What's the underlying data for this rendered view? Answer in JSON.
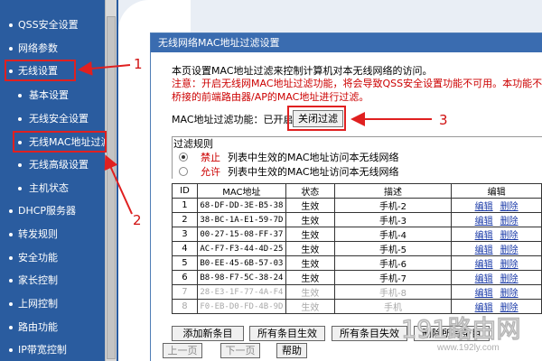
{
  "sidebar": {
    "items": [
      {
        "label": "QSS安全设置"
      },
      {
        "label": "网络参数"
      },
      {
        "label": "无线设置"
      },
      {
        "label": "基本设置"
      },
      {
        "label": "无线安全设置"
      },
      {
        "label": "无线MAC地址过滤"
      },
      {
        "label": "无线高级设置"
      },
      {
        "label": "主机状态"
      },
      {
        "label": "DHCP服务器"
      },
      {
        "label": "转发规则"
      },
      {
        "label": "安全功能"
      },
      {
        "label": "家长控制"
      },
      {
        "label": "上网控制"
      },
      {
        "label": "路由功能"
      },
      {
        "label": "IP带宽控制"
      }
    ]
  },
  "page": {
    "title": "无线网络MAC地址过滤设置",
    "intro": "本页设置MAC地址过滤来控制计算机对本无线网络的访问。",
    "warning_line1": "注意：开启无线网MAC地址过滤功能，将会导致QSS安全设置功能不可用。本功能不对WDS",
    "warning_line2": "桥接的前端路由器/AP的MAC地址进行过滤。",
    "filter_status_label": "MAC地址过滤功能：已开启",
    "close_filter_button": "关闭过滤",
    "rules_title": "过滤规则",
    "rule_options": [
      {
        "keyword": "禁止",
        "text": "列表中生效的MAC地址访问本无线网络",
        "selected": true
      },
      {
        "keyword": "允许",
        "text": "列表中生效的MAC地址访问本无线网络",
        "selected": false
      }
    ]
  },
  "table": {
    "headers": [
      "ID",
      "MAC地址",
      "状态",
      "描述",
      "编辑"
    ],
    "edit_label": "编辑",
    "delete_label": "删除",
    "rows": [
      {
        "id": "1",
        "mac": "68-DF-DD-3E-B5-38",
        "status": "生效",
        "desc": "手机-2"
      },
      {
        "id": "2",
        "mac": "38-BC-1A-E1-59-7D",
        "status": "生效",
        "desc": "手机-3"
      },
      {
        "id": "3",
        "mac": "00-27-15-08-FF-37",
        "status": "生效",
        "desc": "手机-4"
      },
      {
        "id": "4",
        "mac": "AC-F7-F3-44-4D-25",
        "status": "生效",
        "desc": "手机-5"
      },
      {
        "id": "5",
        "mac": "B0-EE-45-6B-57-03",
        "status": "生效",
        "desc": "手机-6"
      },
      {
        "id": "6",
        "mac": "B8-98-F7-5C-38-24",
        "status": "生效",
        "desc": "手机-7"
      },
      {
        "id": "7",
        "mac": "28-E3-1F-77-4A-F4",
        "status": "生效",
        "desc": "手机-8"
      },
      {
        "id": "8",
        "mac": "F0-EB-D0-FD-4B-9D",
        "status": "生效",
        "desc": "手机"
      }
    ]
  },
  "actions": {
    "add_new": "添加新条目",
    "enable_all": "所有条目生效",
    "disable_all": "所有条目失效",
    "delete_all": "删除所有条目",
    "prev_page": "上一页",
    "next_page": "下一页",
    "help": "帮助"
  },
  "annotations": {
    "num1": "1",
    "num2": "2",
    "num3": "3"
  },
  "watermark": {
    "logo_text": "191路由网",
    "url": "www.192ly.com"
  },
  "colors": {
    "sidebar_bg": "#2a5c9f",
    "title_bar_bg": "#3a6cb0",
    "warning_text": "#cc0000",
    "annotation_red": "#e02020",
    "link_blue": "#1a3aa8"
  }
}
